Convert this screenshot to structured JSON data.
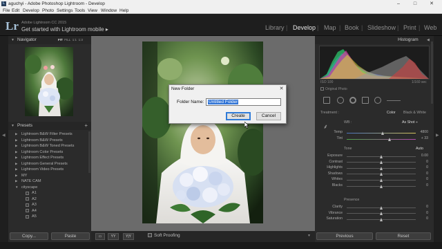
{
  "window": {
    "title": "aguchyi - Adobe Photoshop Lightroom - Develop",
    "controls": {
      "minimize": "–",
      "maximize": "□",
      "close": "✕"
    }
  },
  "menubar": [
    "File",
    "Edit",
    "Develop",
    "Photo",
    "Settings",
    "Tools",
    "View",
    "Window",
    "Help"
  ],
  "identity": {
    "logo": "Lr",
    "version": "Adobe Lightroom CC 2015",
    "mobile": "Get started with Lightroom mobile ▸"
  },
  "modules": [
    "Library",
    "Develop",
    "Map",
    "Book",
    "Slideshow",
    "Print",
    "Web"
  ],
  "active_module": "Develop",
  "left_panel": {
    "navigator": {
      "title": "Navigator",
      "options": [
        "FIT",
        "FILL",
        "1:1",
        "1:3"
      ]
    },
    "presets": {
      "title": "Presets",
      "add_icon": "+",
      "items": [
        {
          "name": "Lightroom B&W Filter Presets",
          "expanded": false
        },
        {
          "name": "Lightroom B&W Presets",
          "expanded": false
        },
        {
          "name": "Lightroom B&W Toned Presets",
          "expanded": false
        },
        {
          "name": "Lightroom Color Presets",
          "expanded": false
        },
        {
          "name": "Lightroom Effect Presets",
          "expanded": false
        },
        {
          "name": "Lightroom General Presets",
          "expanded": false
        },
        {
          "name": "Lightroom Video Presets",
          "expanded": false
        },
        {
          "name": "MY",
          "expanded": false
        },
        {
          "name": "NATE CAM",
          "expanded": false
        },
        {
          "name": "cityscape",
          "expanded": true
        }
      ],
      "sub_items": [
        "A1",
        "A2",
        "A3",
        "A4",
        "A5"
      ]
    },
    "copy_button": "Copy...",
    "paste_button": "Paste"
  },
  "toolbar": {
    "view_buttons": [
      "▭",
      "YY",
      "Y|Y"
    ],
    "soft_proofing": "Soft Proofing"
  },
  "right_panel": {
    "histogram": {
      "title": "Histogram",
      "iso": "ISO 100",
      "shutter": "1/160 sec",
      "original_photo": "Original Photo"
    },
    "basic": {
      "treatment_label": "Treatment :",
      "color": "Color",
      "bw": "Black & White",
      "wb_label": "WB :",
      "wb_value": "As Shot ÷",
      "temp": {
        "label": "Temp",
        "value": "4800",
        "pos": 0.52
      },
      "tint": {
        "label": "Tint",
        "value": "+ 33",
        "pos": 0.62
      },
      "tone_label": "Tone",
      "auto": "Auto",
      "sliders": [
        {
          "label": "Exposure",
          "value": "0.00",
          "pos": 0.5
        },
        {
          "label": "Contrast",
          "value": "0",
          "pos": 0.5
        },
        {
          "label": "Highlights",
          "value": "0",
          "pos": 0.5
        },
        {
          "label": "Shadows",
          "value": "0",
          "pos": 0.5
        },
        {
          "label": "Whites",
          "value": "0",
          "pos": 0.5
        },
        {
          "label": "Blacks",
          "value": "0",
          "pos": 0.5
        }
      ],
      "presence_label": "Presence",
      "presence": [
        {
          "label": "Clarity",
          "value": "0",
          "pos": 0.5
        },
        {
          "label": "Vibrance",
          "value": "0",
          "pos": 0.5
        },
        {
          "label": "Saturation",
          "value": "0",
          "pos": 0.5
        }
      ]
    },
    "previous_button": "Previous",
    "reset_button": "Reset"
  },
  "dialog": {
    "title": "New Folder",
    "close": "✕",
    "folder_label": "Folder Name:",
    "folder_value": "Untitled Folder",
    "create_button": "Create",
    "cancel_button": "Cancel"
  },
  "colors": {
    "accent_blue": "#3074d6",
    "panel_bg": "#2b2b2b",
    "canvas_bg": "#6b6b6b"
  }
}
